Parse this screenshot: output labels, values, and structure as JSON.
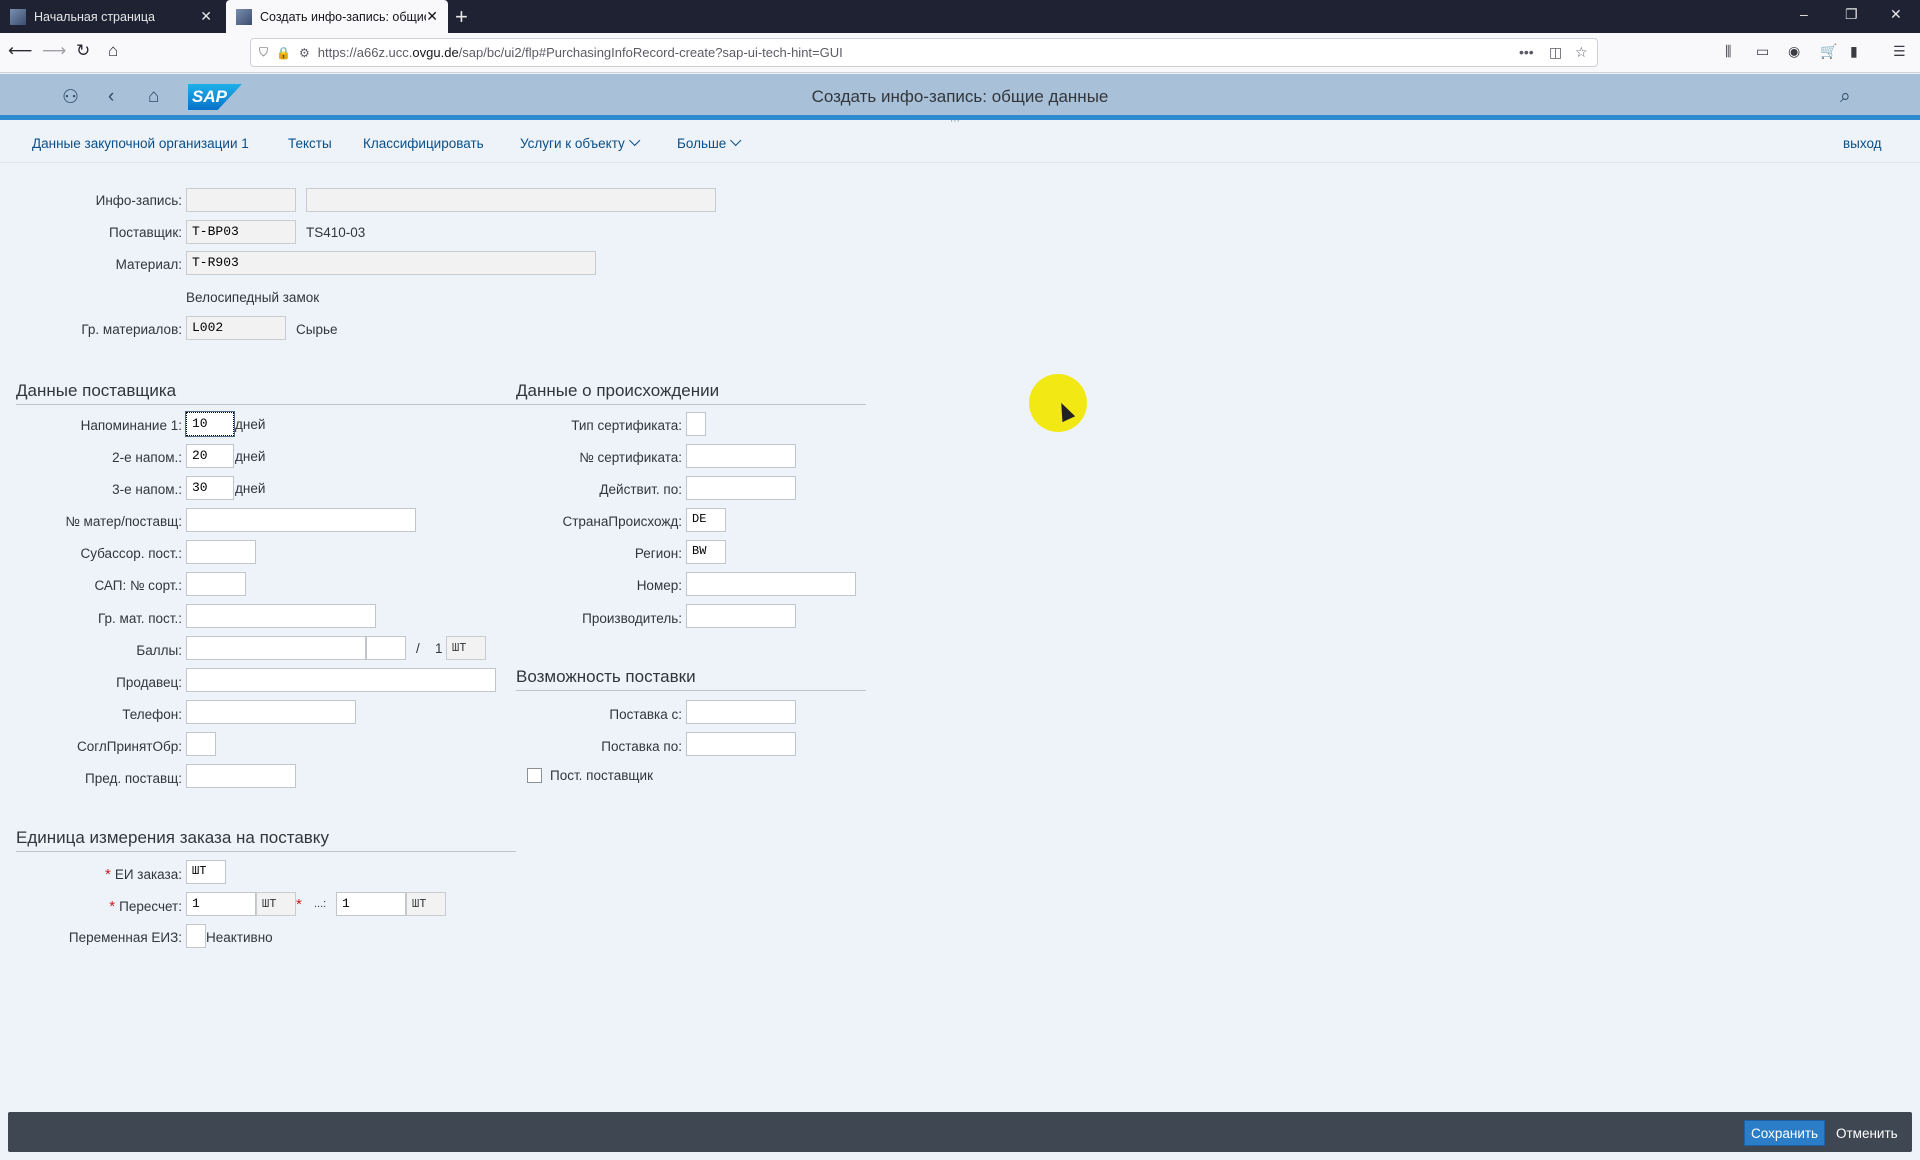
{
  "browser": {
    "tabs": [
      {
        "title": "Начальная страница"
      },
      {
        "title": "Создать инфо-запись: общие"
      }
    ],
    "new_tab": "+",
    "window": {
      "minimize": "–",
      "restore": "❐",
      "close": "✕"
    },
    "url_prefix": "https://a66z.ucc.",
    "url_domain": "ovgu.de",
    "url_suffix": "/sap/bc/ui2/flp#PurchasingInfoRecord-create?sap-ui-tech-hint=GUI"
  },
  "shell": {
    "logo": "SAP",
    "title": "Создать инфо-запись: общие данные",
    "grip": "⋯"
  },
  "menu": {
    "items": [
      "Данные закупочной организации 1",
      "Тексты",
      "Классифицировать",
      "Услуги к объекту",
      "Больше"
    ],
    "exit": "выход"
  },
  "header": {
    "info_record": {
      "label": "Инфо-запись:",
      "value": "",
      "value2": ""
    },
    "vendor": {
      "label": "Поставщик:",
      "value": "T-BP03",
      "desc": "TS410-03"
    },
    "material": {
      "label": "Материал:",
      "value": "T-R903",
      "desc": "Велосипедный замок"
    },
    "mat_group": {
      "label": "Гр. материалов:",
      "value": "L002",
      "desc": "Сырье"
    }
  },
  "vendor_data": {
    "title": "Данные поставщика",
    "reminder1": {
      "label": "Напоминание 1:",
      "value": "10",
      "unit": "дней"
    },
    "reminder2": {
      "label": "2-е напом.:",
      "value": "20",
      "unit": "дней"
    },
    "reminder3": {
      "label": "3-е напом.:",
      "value": "30",
      "unit": "дней"
    },
    "vendor_mat_no": {
      "label": "№ матер/поставщ:",
      "value": ""
    },
    "subrange": {
      "label": "Субассор. пост.:",
      "value": ""
    },
    "vsr_sort": {
      "label": "САП: № сорт.:",
      "value": ""
    },
    "vendor_mat_group": {
      "label": "Гр. мат. пост.:",
      "value": ""
    },
    "points": {
      "label": "Баллы:",
      "value": "",
      "value2": "",
      "slash": "/",
      "per": "1",
      "unit": "ШТ"
    },
    "salesperson": {
      "label": "Продавец:",
      "value": ""
    },
    "telephone": {
      "label": "Телефон:",
      "value": ""
    },
    "return_agreement": {
      "label": "СоглПринятОбр:",
      "value": ""
    },
    "prior_vendor": {
      "label": "Пред. поставщ:",
      "value": ""
    }
  },
  "origin_data": {
    "title": "Данные о происхождении",
    "cert_type": {
      "label": "Тип сертификата:",
      "value": ""
    },
    "cert_no": {
      "label": "№ сертификата:",
      "value": ""
    },
    "valid_to": {
      "label": "Действит. по:",
      "value": ""
    },
    "country": {
      "label": "СтранаПроисхожд:",
      "value": "DE"
    },
    "region": {
      "label": "Регион:",
      "value": "BW"
    },
    "number": {
      "label": "Номер:",
      "value": ""
    },
    "manufacturer": {
      "label": "Производитель:",
      "value": ""
    }
  },
  "supply": {
    "title": "Возможность поставки",
    "from": {
      "label": "Поставка с:",
      "value": ""
    },
    "to": {
      "label": "Поставка по:",
      "value": ""
    },
    "regular_vendor": {
      "label": "Пост. поставщик",
      "checked": false
    }
  },
  "order_unit": {
    "title": "Единица измерения заказа на поставку",
    "required_mark": "*",
    "order_unit": {
      "label": "ЕИ заказа:",
      "value": "ШТ"
    },
    "conversion": {
      "label": "Пересчет:",
      "value1": "1",
      "unit1": "ШТ",
      "sep": "...:",
      "value2": "1",
      "unit2": "ШТ"
    },
    "variable_ou": {
      "label": "Переменная ЕИЗ:",
      "value": "",
      "desc": "Неактивно"
    }
  },
  "footer": {
    "save": "Сохранить",
    "cancel": "Отменить"
  },
  "colors": {
    "shell": "#a8c1d9",
    "accent": "#2f8bd0",
    "footer": "#3e4752",
    "save": "#2b7dc8",
    "highlight": "#f2e800"
  }
}
